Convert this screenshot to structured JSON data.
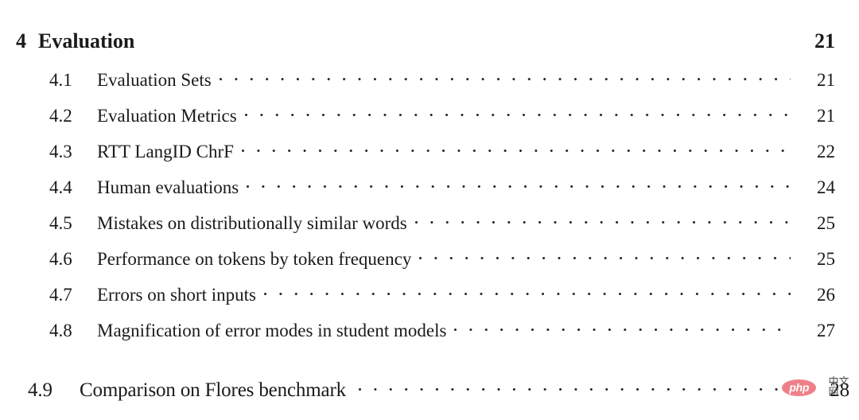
{
  "document": {
    "type": "table-of-contents",
    "background_color": "#ffffff",
    "text_color": "#1a1a1c"
  },
  "chapter": {
    "number": "4",
    "title": "Evaluation",
    "page": "21"
  },
  "sections": [
    {
      "number": "4.1",
      "title": "Evaluation Sets",
      "page": "21"
    },
    {
      "number": "4.2",
      "title": "Evaluation Metrics",
      "page": "21"
    },
    {
      "number": "4.3",
      "title": "RTT LangID ChrF",
      "page": "22"
    },
    {
      "number": "4.4",
      "title": "Human evaluations",
      "page": "24"
    },
    {
      "number": "4.5",
      "title": "Mistakes on distributionally similar words",
      "page": "25"
    },
    {
      "number": "4.6",
      "title": "Performance on tokens by token frequency",
      "page": "25"
    },
    {
      "number": "4.7",
      "title": "Errors on short inputs",
      "page": "26"
    },
    {
      "number": "4.8",
      "title": "Magnification of error modes in student models",
      "page": "27"
    },
    {
      "number": "4.9",
      "title": "Comparison on Flores benchmark",
      "page": "28"
    }
  ],
  "watermark": {
    "badge_text": "php",
    "suffix_text": "中文网",
    "badge_color": "#ef8089",
    "badge_text_color": "#ffffff"
  }
}
